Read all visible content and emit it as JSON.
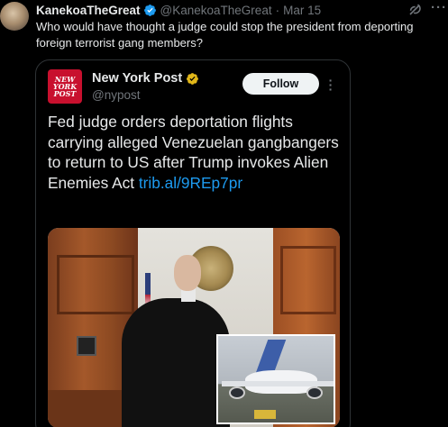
{
  "post": {
    "display_name": "KanekoaTheGreat",
    "handle": "@KanekoaTheGreat",
    "separator": "·",
    "date": "Mar 15",
    "text": "Who would have thought a judge could stop the president from deporting foreign terrorist gang members?",
    "avatar_icon": "avatar",
    "verified_icon": "verified-badge-icon",
    "grok_icon": "grok-icon",
    "more_icon": "more-icon",
    "more_label": "···"
  },
  "quote": {
    "display_name": "New York Post",
    "handle": "@nypost",
    "logo_lines": [
      "NEW",
      "YORK",
      "POST"
    ],
    "follow_label": "Follow",
    "text": "Fed judge orders deportation flights carrying alleged Venezuelan gangbangers to return to US after Trump invokes Alien Enemies Act ",
    "link_text": "trib.al/9REp7pr",
    "media_alt": "Judge in courtroom with inset photo of airplane"
  },
  "colors": {
    "background": "#000000",
    "text_primary": "#e7e9ea",
    "text_secondary": "#71767b",
    "link": "#1d9bf0",
    "verified": "#1d9bf0",
    "quote_verified": "#e2b719",
    "nypost_red": "#c8102e",
    "border": "#2f3336"
  }
}
